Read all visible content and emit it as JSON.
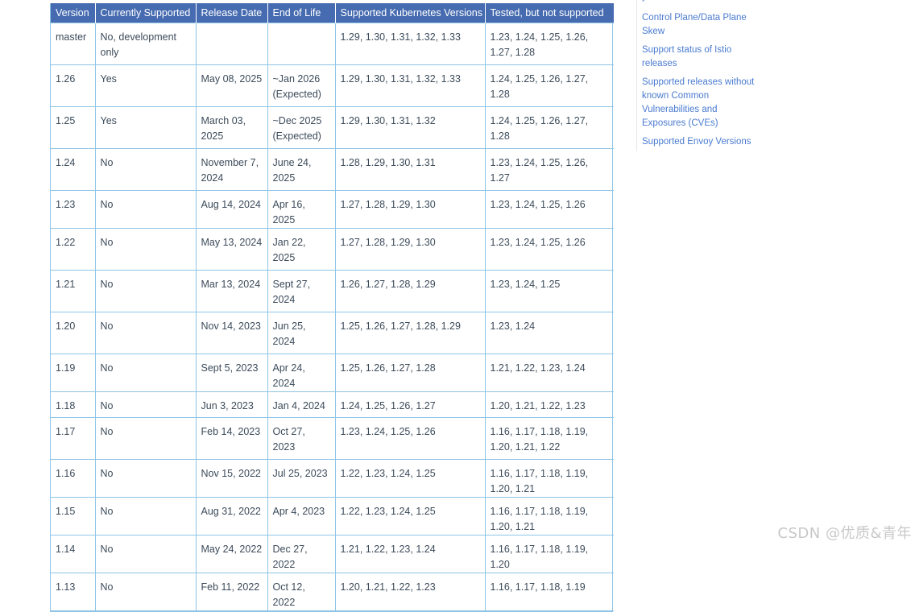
{
  "table": {
    "headers": [
      "Version",
      "Currently Supported",
      "Release Date",
      "End of Life",
      "Supported Kubernetes Versions",
      "Tested, but not supported"
    ],
    "rows": [
      {
        "version": "master",
        "supported": "No, development only",
        "release": "",
        "eol": "",
        "k8s": "1.29, 1.30, 1.31, 1.32, 1.33",
        "tested": "1.23, 1.24, 1.25, 1.26, 1.27, 1.28"
      },
      {
        "version": "1.26",
        "supported": "Yes",
        "release": "May 08, 2025",
        "eol": "~Jan 2026 (Expected)",
        "k8s": "1.29, 1.30, 1.31, 1.32, 1.33",
        "tested": "1.24, 1.25, 1.26, 1.27, 1.28"
      },
      {
        "version": "1.25",
        "supported": "Yes",
        "release": "March 03, 2025",
        "eol": "~Dec 2025 (Expected)",
        "k8s": "1.29, 1.30, 1.31, 1.32",
        "tested": "1.24, 1.25, 1.26, 1.27, 1.28"
      },
      {
        "version": "1.24",
        "supported": "No",
        "release": "November 7, 2024",
        "eol": "June 24, 2025",
        "k8s": "1.28, 1.29, 1.30, 1.31",
        "tested": "1.23, 1.24, 1.25, 1.26, 1.27"
      },
      {
        "version": "1.23",
        "supported": "No",
        "release": "Aug 14, 2024",
        "eol": "Apr 16, 2025",
        "k8s": "1.27, 1.28, 1.29, 1.30",
        "tested": "1.23, 1.24, 1.25, 1.26"
      },
      {
        "version": "1.22",
        "supported": "No",
        "release": "May 13, 2024",
        "eol": "Jan 22, 2025",
        "k8s": "1.27, 1.28, 1.29, 1.30",
        "tested": "1.23, 1.24, 1.25, 1.26"
      },
      {
        "version": "1.21",
        "supported": "No",
        "release": "Mar 13, 2024",
        "eol": "Sept 27, 2024",
        "k8s": "1.26, 1.27, 1.28, 1.29",
        "tested": "1.23, 1.24, 1.25"
      },
      {
        "version": "1.20",
        "supported": "No",
        "release": "Nov 14, 2023",
        "eol": "Jun 25, 2024",
        "k8s": "1.25, 1.26, 1.27, 1.28, 1.29",
        "tested": "1.23, 1.24"
      },
      {
        "version": "1.19",
        "supported": "No",
        "release": "Sept 5, 2023",
        "eol": "Apr 24, 2024",
        "k8s": "1.25, 1.26, 1.27, 1.28",
        "tested": "1.21, 1.22, 1.23, 1.24"
      },
      {
        "version": "1.18",
        "supported": "No",
        "release": "Jun 3, 2023",
        "eol": "Jan 4, 2024",
        "k8s": "1.24, 1.25, 1.26, 1.27",
        "tested": "1.20, 1.21, 1.22, 1.23"
      },
      {
        "version": "1.17",
        "supported": "No",
        "release": "Feb 14, 2023",
        "eol": "Oct 27, 2023",
        "k8s": "1.23, 1.24, 1.25, 1.26",
        "tested": "1.16, 1.17, 1.18, 1.19, 1.20, 1.21, 1.22"
      },
      {
        "version": "1.16",
        "supported": "No",
        "release": "Nov 15, 2022",
        "eol": "Jul 25, 2023",
        "k8s": "1.22, 1.23, 1.24, 1.25",
        "tested": "1.16, 1.17, 1.18, 1.19, 1.20, 1.21"
      },
      {
        "version": "1.15",
        "supported": "No",
        "release": "Aug 31, 2022",
        "eol": "Apr 4, 2023",
        "k8s": "1.22, 1.23, 1.24, 1.25",
        "tested": "1.16, 1.17, 1.18, 1.19, 1.20, 1.21"
      },
      {
        "version": "1.14",
        "supported": "No",
        "release": "May 24, 2022",
        "eol": "Dec 27, 2022",
        "k8s": "1.21, 1.22, 1.23, 1.24",
        "tested": "1.16, 1.17, 1.18, 1.19, 1.20"
      },
      {
        "version": "1.13",
        "supported": "No",
        "release": "Feb 11, 2022",
        "eol": "Oct 12, 2022",
        "k8s": "1.20, 1.21, 1.22, 1.23",
        "tested": "1.16, 1.17, 1.18, 1.19"
      }
    ]
  },
  "toc": {
    "top_fragment": "y",
    "items": [
      "Control Plane/Data Plane Skew",
      "Support status of Istio releases",
      "Supported releases without known Common Vulnerabilities and Exposures (CVEs)",
      "Supported Envoy Versions"
    ]
  },
  "watermark": "CSDN @优质&青年",
  "colors": {
    "header_bg": "#466bb0",
    "border": "#8ec5e6",
    "link": "#4a7bd0"
  }
}
